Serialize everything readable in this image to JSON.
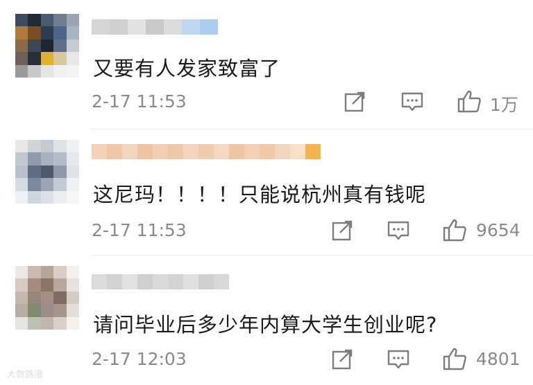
{
  "comments": [
    {
      "username": "",
      "text": "又要有人发家致富了",
      "time": "2-17 11:53",
      "likes": "1万",
      "share_icon": "share-icon",
      "reply_icon": "comment-icon",
      "like_icon": "thumbs-up-icon"
    },
    {
      "username": "",
      "text": "这尼玛！！！！只能说杭州真有钱呢",
      "time": "2-17 11:53",
      "likes": "9654",
      "share_icon": "share-icon",
      "reply_icon": "comment-icon",
      "like_icon": "thumbs-up-icon"
    },
    {
      "username": "",
      "text": "请问毕业后多少年内算大学生创业呢?",
      "time": "2-17 12:03",
      "likes": "4801",
      "share_icon": "share-icon",
      "reply_icon": "comment-icon",
      "like_icon": "thumbs-up-icon"
    }
  ],
  "watermark": "大数路漫",
  "colors": {
    "meta_gray": "#8a8a8a",
    "text": "#1a1a1a",
    "divider": "#ececec"
  }
}
